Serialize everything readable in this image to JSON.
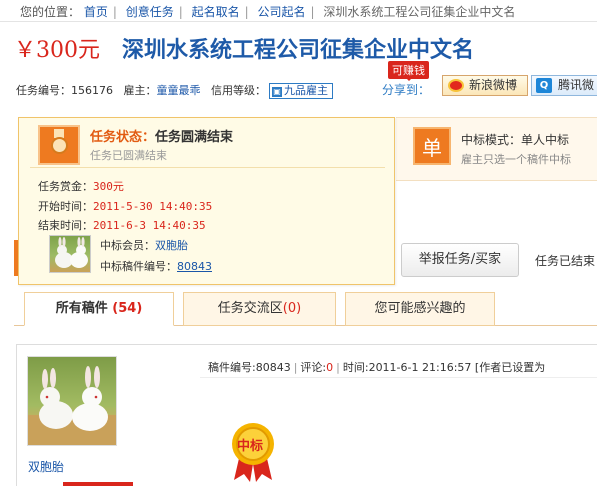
{
  "breadcrumb": {
    "label": "您的位置：",
    "items": [
      "首页",
      "创意任务",
      "起名取名",
      "公司起名"
    ],
    "current": "深圳水系统工程公司征集企业中文名"
  },
  "task": {
    "price": "￥300元",
    "title": "深圳水系统工程公司征集企业中文名",
    "id_label": "任务编号：",
    "id_value": "156176",
    "employer_label": "雇主：",
    "employer": "童童最乖",
    "credit_label": "信用等级：",
    "credit_value": "九品雇主"
  },
  "share": {
    "earn_tag": "可赚钱",
    "label": "分享到：",
    "weibo": "新浪微博",
    "tencent": "腾讯微"
  },
  "bid_mode": {
    "icon_text": "单",
    "mode": "中标模式：单人中标",
    "sub": "雇主只选一个稿件中标"
  },
  "status_card": {
    "title_key": "任务状态：",
    "title_value": "任务圆满结束",
    "subtitle": "任务已圆满结束",
    "reward_label": "任务赏金：",
    "reward_value": "300元",
    "start_label": "开始时间：",
    "start_value": "2011-5-30 14:40:35",
    "end_label": "结束时间：",
    "end_value": "2011-6-3 14:40:35",
    "winner_label": "中标会员：",
    "winner_value": "双胞胎",
    "winner_entry_label": "中标稿件编号：",
    "winner_entry_value": "80843"
  },
  "actions": {
    "report": "举报任务/买家",
    "ended": "任务已结束"
  },
  "tabs": [
    {
      "label": "所有稿件",
      "count": "(54)"
    },
    {
      "label": "任务交流区",
      "count": "(0)"
    },
    {
      "label": "您可能感兴趣的",
      "count": ""
    }
  ],
  "entry": {
    "author": "双胞胎",
    "id_text": "稿件编号:80843",
    "comment_label": "评论:",
    "comment_count": "0",
    "time_text": "时间:2011-6-1 21:16:57",
    "note": "[作者已设置为",
    "badge_text": "中标"
  },
  "colors": {
    "price_red": "#d9261c",
    "title_blue": "#1e5aa8",
    "accent_orange": "#ee7a20"
  }
}
